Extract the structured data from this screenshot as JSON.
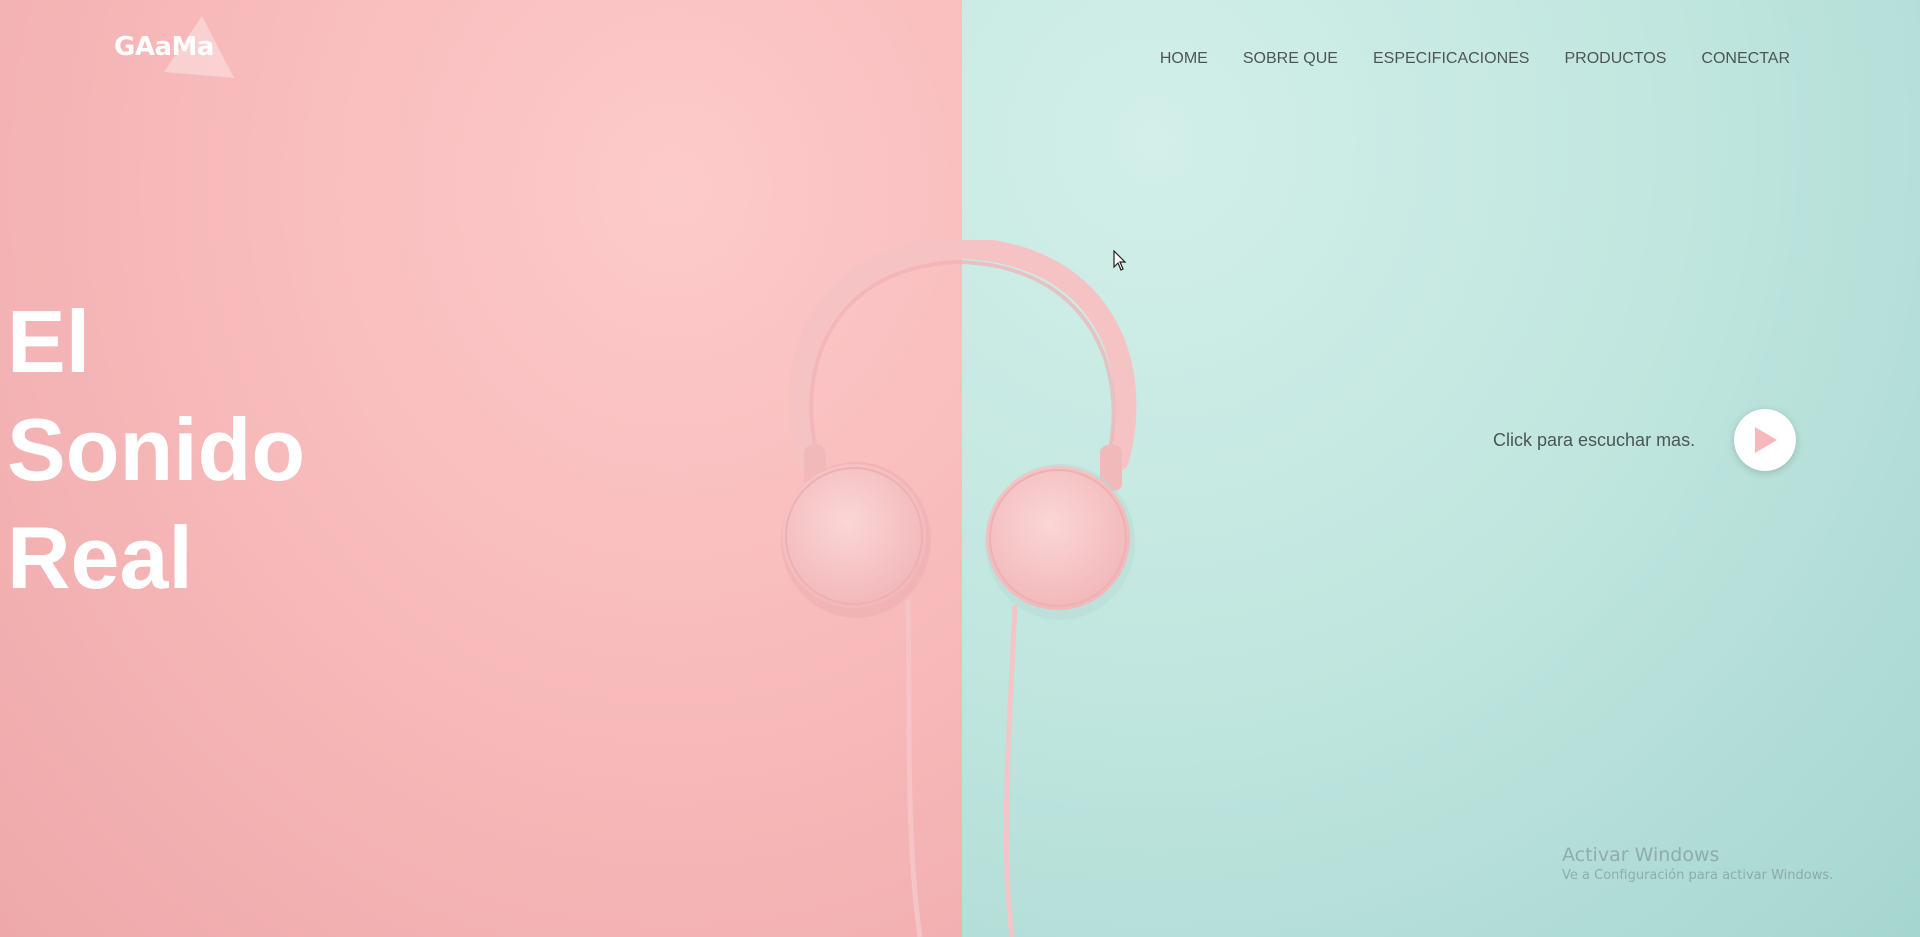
{
  "logo": {
    "text": "GAaMa"
  },
  "nav": {
    "items": [
      {
        "label": "HOME"
      },
      {
        "label": "SOBRE QUE"
      },
      {
        "label": "ESPECIFICACIONES"
      },
      {
        "label": "PRODUCTOS"
      },
      {
        "label": "CONECTAR"
      }
    ]
  },
  "hero": {
    "line1": "El",
    "line2": "Sonido",
    "line3": "Real"
  },
  "play": {
    "label": "Click para escuchar mas.",
    "icon": "play-icon"
  },
  "watermark": {
    "title": "Activar Windows",
    "subtitle": "Ve a Configuración para activar Windows."
  },
  "colors": {
    "left_bg": "#f9bdbd",
    "right_bg": "#c2e7e0",
    "accent": "#f7b8bb",
    "text_dark": "#4f5555"
  }
}
